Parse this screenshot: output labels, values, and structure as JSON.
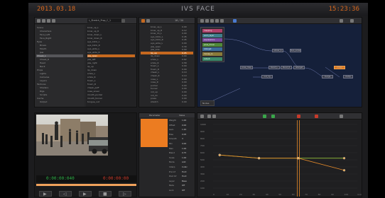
{
  "app": {
    "title": "IVS FACE",
    "date": "2013.03.18",
    "clock": "15:23:36"
  },
  "browser": {
    "dropdown": "L_Stretch_Prop_C_1",
    "tree": [
      "Scene",
      "Characters",
      "Face_Left",
      "Face_Right",
      "Eyes",
      "Brows",
      "Mouth",
      "Jaw",
      "Cheek_L",
      "Cheek_R",
      "Head",
      "Neck",
      "Props",
      "Lights",
      "Cameras",
      "Layers",
      "Textures",
      "Shaders",
      "Rigs",
      "Scripts",
      "Cache",
      "Output"
    ],
    "tree_selected_index": 8,
    "clips": [
      "brow_up_L",
      "brow_up_R",
      "brow_down_L",
      "brow_down_R",
      "eye_blink_L",
      "eye_blink_R",
      "eye_wide_L",
      "eye_wide_R",
      "jaw_open",
      "jaw_left",
      "jaw_right",
      "lip_up",
      "lip_down",
      "smile_L",
      "smile_R",
      "frown_L",
      "frown_R",
      "cheek_puff",
      "nose_sneer",
      "mouth_pucker",
      "mouth_funnel",
      "tongue_out"
    ],
    "clips_highlight_index": 8
  },
  "channels": {
    "count": "16 / 34",
    "names": [
      "brow_up_L",
      "brow_up_R",
      "brow_dn_L",
      "eye_blink_L",
      "eye_blink_R",
      "eye_wide_L",
      "jaw_open",
      "jaw_side",
      "lip_up",
      "lip_down",
      "smile_L",
      "smile_R",
      "frown_L",
      "frown_R",
      "cheek_L",
      "cheek_R",
      "nose_L",
      "nose_R",
      "pucker",
      "funnel",
      "roll_up",
      "roll_dn",
      "press",
      "stretch"
    ],
    "values": [
      "0.00",
      "0.12",
      "0.00",
      "0.45",
      "0.45",
      "0.00",
      "0.30",
      "0.00",
      "0.05",
      "0.00",
      "0.62",
      "0.58",
      "0.00",
      "0.00",
      "0.10",
      "0.10",
      "0.00",
      "0.00",
      "0.00",
      "0.00",
      "0.00",
      "0.00",
      "0.00",
      "0.00"
    ],
    "highlight_index": 8
  },
  "graph": {
    "controls": [
      "mapping",
      "anim_layer",
      "expressions",
      "pose_driver",
      "retarget",
      "mocap_in",
      "output"
    ],
    "control_colors": [
      "#b0406a",
      "#3f7f8c",
      "#7a4aa0",
      "#4f8a3a",
      "#3b6c9a",
      "#8a7a3a",
      "#3a8a6a"
    ],
    "nodes": [
      "solver_A",
      "face_solver",
      "pose_map",
      "blend_L",
      "blend_R",
      "retarget",
      "mixer",
      "out_rig",
      "merge",
      "clamp"
    ],
    "hot_node_index": 6,
    "menu_button": "Nodes"
  },
  "viewer": {
    "timecode_current": "0:00:00:040",
    "timecode_duration": "0:00:00:00",
    "transport": [
      "go-to-start",
      "step-back",
      "play",
      "stop",
      "step-forward"
    ]
  },
  "attributes": {
    "header": [
      "Parameter",
      "Value"
    ],
    "rows": [
      {
        "name": "Weight",
        "value": "1.00"
      },
      {
        "name": "Offset",
        "value": "0.00"
      },
      {
        "name": "Gain",
        "value": "1.20"
      },
      {
        "name": "Bias",
        "value": "0.05"
      },
      {
        "name": "Smooth",
        "value": "3"
      },
      {
        "name": "Min",
        "value": "0.00"
      },
      {
        "name": "Max",
        "value": "1.00"
      },
      {
        "name": "Blend",
        "value": "0.75"
      },
      {
        "name": "Scale",
        "value": "1.00"
      },
      {
        "name": "Mode",
        "value": "Add"
      },
      {
        "name": "Interp",
        "value": "Cubic"
      },
      {
        "name": "Pre Inf",
        "value": "Hold"
      },
      {
        "name": "Post Inf",
        "value": "Hold"
      },
      {
        "name": "Layer",
        "value": "Base"
      },
      {
        "name": "Mute",
        "value": "Off"
      },
      {
        "name": "Lock",
        "value": "Off"
      }
    ]
  },
  "curves": {
    "y_ticks": [
      "1000",
      "900",
      "800",
      "700",
      "600",
      "500",
      "400",
      "300",
      "200",
      "100"
    ],
    "x_ticks": [
      "0",
      "10",
      "20",
      "30",
      "40",
      "50",
      "60",
      "70",
      "80",
      "90",
      "100",
      "110"
    ],
    "playhead": 65
  },
  "chart_data": {
    "type": "line",
    "xlim": [
      0,
      110
    ],
    "ylim": [
      0,
      1000
    ],
    "series": [
      {
        "values": [
          [
            5,
            520
          ],
          [
            35,
            470
          ],
          [
            65,
            470
          ],
          [
            100,
            470
          ]
        ]
      },
      {
        "values": [
          [
            5,
            520
          ],
          [
            35,
            470
          ],
          [
            65,
            470
          ],
          [
            100,
            280
          ]
        ]
      }
    ],
    "colors": [
      "#93c03a",
      "#e3892a"
    ]
  }
}
